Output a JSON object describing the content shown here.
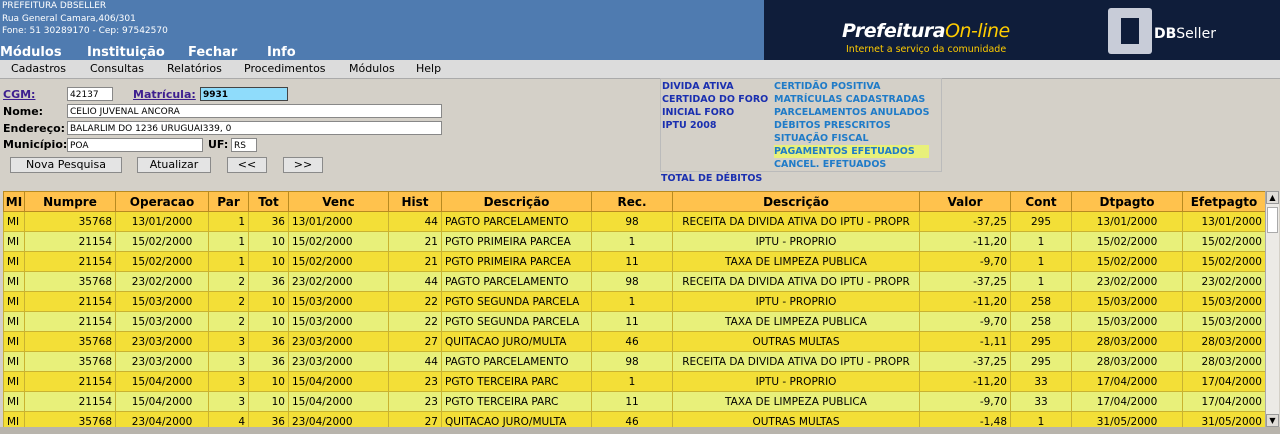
{
  "header": {
    "org": "PREFEITURA DBSELLER",
    "address": "Rua General Camara,406/301",
    "phone": "Fone: 51 30289170  -  Cep: 97542570",
    "banner_pref": "Prefeitura",
    "banner_online": "On-line",
    "banner_sub": "Internet a serviço da comunidade",
    "banner_db": "DB",
    "banner_seller": "Seller"
  },
  "topmenu": [
    "Módulos",
    "Instituição",
    "Fechar",
    "Info"
  ],
  "menubar": [
    "Cadastros",
    "Consultas",
    "Relatórios",
    "Procedimentos",
    "Módulos",
    "Help"
  ],
  "form": {
    "cgm_label": "CGM:",
    "cgm_value": "42137",
    "matricula_label": "Matrícula:",
    "matricula_value": "9931",
    "nome_label": "Nome:",
    "nome_value": "CELIO JUVENAL ANCORA",
    "endereco_label": "Endereço:",
    "endereco_value": "BALARLIM DO 1236 URUGUAI339, 0",
    "municipio_label": "Município:",
    "municipio_value": "POA",
    "uf_label": "UF:",
    "uf_value": "RS",
    "btn_nova": "Nova Pesquisa",
    "btn_atualizar": "Atualizar",
    "btn_prev": "<<",
    "btn_next": ">>"
  },
  "links_left": [
    "DIVIDA ATIVA",
    "CERTIDAO DO FORO",
    "INICIAL FORO",
    "IPTU 2008"
  ],
  "links_right": [
    "CERTIDÃO POSITIVA",
    "MATRÍCULAS CADASTRADAS",
    "PARCELAMENTOS ANULADOS",
    "DÉBITOS PRESCRITOS",
    "SITUAÇÃO FISCAL",
    "PAGAMENTOS EFETUADOS",
    "CANCEL. EFETUADOS"
  ],
  "total_label": "TOTAL DE DÉBITOS",
  "table": {
    "columns": [
      "MI",
      "Numpre",
      "Operacao",
      "Par",
      "Tot",
      "Venc",
      "Hist",
      "Descrição",
      "Rec.",
      "Descrição",
      "Valor",
      "Cont",
      "Dtpagto",
      "Efetpagto"
    ],
    "rows": [
      [
        "MI",
        "35768",
        "13/01/2000",
        "1",
        "36",
        "13/01/2000",
        "44",
        "PAGTO PARCELAMENTO",
        "98",
        "RECEITA DA DIVIDA ATIVA DO IPTU - PROPR",
        "-37,25",
        "295",
        "13/01/2000",
        "13/01/2000"
      ],
      [
        "MI",
        "21154",
        "15/02/2000",
        "1",
        "10",
        "15/02/2000",
        "21",
        "PGTO PRIMEIRA PARCEA",
        "1",
        "IPTU - PROPRIO",
        "-11,20",
        "1",
        "15/02/2000",
        "15/02/2000"
      ],
      [
        "MI",
        "21154",
        "15/02/2000",
        "1",
        "10",
        "15/02/2000",
        "21",
        "PGTO PRIMEIRA PARCEA",
        "11",
        "TAXA DE LIMPEZA PUBLICA",
        "-9,70",
        "1",
        "15/02/2000",
        "15/02/2000"
      ],
      [
        "MI",
        "35768",
        "23/02/2000",
        "2",
        "36",
        "23/02/2000",
        "44",
        "PAGTO PARCELAMENTO",
        "98",
        "RECEITA DA DIVIDA ATIVA DO IPTU - PROPR",
        "-37,25",
        "1",
        "23/02/2000",
        "23/02/2000"
      ],
      [
        "MI",
        "21154",
        "15/03/2000",
        "2",
        "10",
        "15/03/2000",
        "22",
        "PGTO SEGUNDA PARCELA",
        "1",
        "IPTU - PROPRIO",
        "-11,20",
        "258",
        "15/03/2000",
        "15/03/2000"
      ],
      [
        "MI",
        "21154",
        "15/03/2000",
        "2",
        "10",
        "15/03/2000",
        "22",
        "PGTO SEGUNDA PARCELA",
        "11",
        "TAXA DE LIMPEZA PUBLICA",
        "-9,70",
        "258",
        "15/03/2000",
        "15/03/2000"
      ],
      [
        "MI",
        "35768",
        "23/03/2000",
        "3",
        "36",
        "23/03/2000",
        "27",
        "QUITACAO JURO/MULTA",
        "46",
        "OUTRAS MULTAS",
        "-1,11",
        "295",
        "28/03/2000",
        "28/03/2000"
      ],
      [
        "MI",
        "35768",
        "23/03/2000",
        "3",
        "36",
        "23/03/2000",
        "44",
        "PAGTO PARCELAMENTO",
        "98",
        "RECEITA DA DIVIDA ATIVA DO IPTU - PROPR",
        "-37,25",
        "295",
        "28/03/2000",
        "28/03/2000"
      ],
      [
        "MI",
        "21154",
        "15/04/2000",
        "3",
        "10",
        "15/04/2000",
        "23",
        "PGTO TERCEIRA PARC",
        "1",
        "IPTU - PROPRIO",
        "-11,20",
        "33",
        "17/04/2000",
        "17/04/2000"
      ],
      [
        "MI",
        "21154",
        "15/04/2000",
        "3",
        "10",
        "15/04/2000",
        "23",
        "PGTO TERCEIRA PARC",
        "11",
        "TAXA DE LIMPEZA PUBLICA",
        "-9,70",
        "33",
        "17/04/2000",
        "17/04/2000"
      ],
      [
        "MI",
        "35768",
        "23/04/2000",
        "4",
        "36",
        "23/04/2000",
        "27",
        "QUITACAO JURO/MULTA",
        "46",
        "OUTRAS MULTAS",
        "-1,48",
        "1",
        "31/05/2000",
        "31/05/2000"
      ]
    ]
  },
  "scrollbar": {
    "up_glyph": "▲",
    "down_glyph": "▼"
  }
}
